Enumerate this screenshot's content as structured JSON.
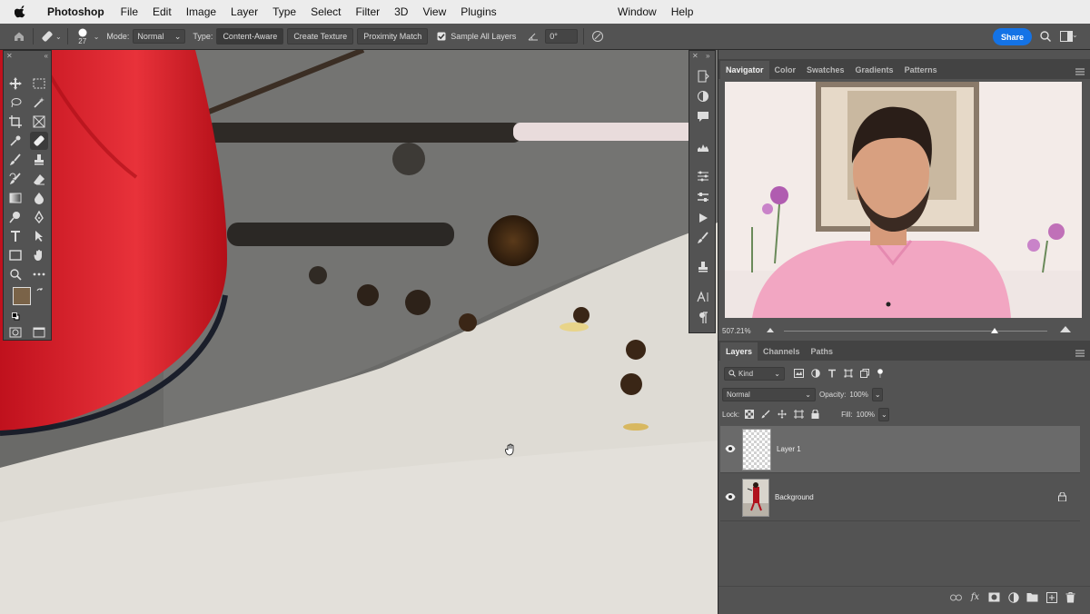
{
  "menubar": {
    "app_name": "Photoshop",
    "items": [
      "File",
      "Edit",
      "Image",
      "Layer",
      "Type",
      "Select",
      "Filter",
      "3D",
      "View",
      "Plugins"
    ],
    "right_items": [
      "Window",
      "Help"
    ]
  },
  "options_bar": {
    "brush_size": "27",
    "mode_label": "Mode:",
    "mode_value": "Normal",
    "type_label": "Type:",
    "type_buttons": [
      "Content-Aware",
      "Create Texture",
      "Proximity Match"
    ],
    "sample_all_layers_label": "Sample All Layers",
    "sample_all_layers_checked": true,
    "angle_value": "0°",
    "share_label": "Share"
  },
  "toolbox": {
    "foreground_color": "#7a6348",
    "background_color": "#b29c78"
  },
  "navigator_panel": {
    "tabs": [
      "Navigator",
      "Color",
      "Swatches",
      "Gradients",
      "Patterns"
    ],
    "active_tab": "Navigator",
    "zoom_value": "507.21%",
    "zoom_slider_level": 0.8
  },
  "layers_panel": {
    "tabs": [
      "Layers",
      "Channels",
      "Paths"
    ],
    "active_tab": "Layers",
    "filter_kind": "Kind",
    "blend_mode": "Normal",
    "opacity_label": "Opacity:",
    "opacity_value": "100%",
    "lock_label": "Lock:",
    "fill_label": "Fill:",
    "fill_value": "100%",
    "layers": [
      {
        "name": "Layer 1",
        "visible": true,
        "selected": true,
        "locked": false
      },
      {
        "name": "Background",
        "visible": true,
        "selected": false,
        "locked": true
      }
    ]
  },
  "colors": {
    "accent": "#1473e6",
    "panel_bg": "#535353",
    "selected_layer": "#6a6a6a"
  }
}
